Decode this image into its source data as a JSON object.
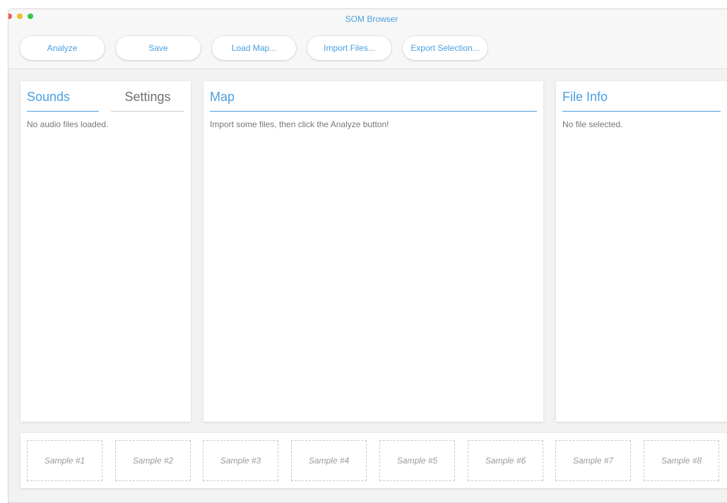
{
  "window": {
    "title": "SOM Browser"
  },
  "toolbar": {
    "analyze": "Analyze",
    "save": "Save",
    "load_map": "Load Map...",
    "import_files": "Import Files...",
    "export_selection": "Export Selection..."
  },
  "sounds_panel": {
    "tabs": [
      "Sounds",
      "Settings"
    ],
    "message": "No audio files loaded."
  },
  "map_panel": {
    "title": "Map",
    "message": "Import some files, then click the Analyze button!"
  },
  "info_panel": {
    "title": "File Info",
    "message": "No file selected."
  },
  "samples": [
    "Sample #1",
    "Sample #2",
    "Sample #3",
    "Sample #4",
    "Sample #5",
    "Sample #6",
    "Sample #7",
    "Sample #8"
  ],
  "colors": {
    "accent": "#4a9fe0",
    "background": "#f2f2f2",
    "panel": "#ffffff"
  }
}
